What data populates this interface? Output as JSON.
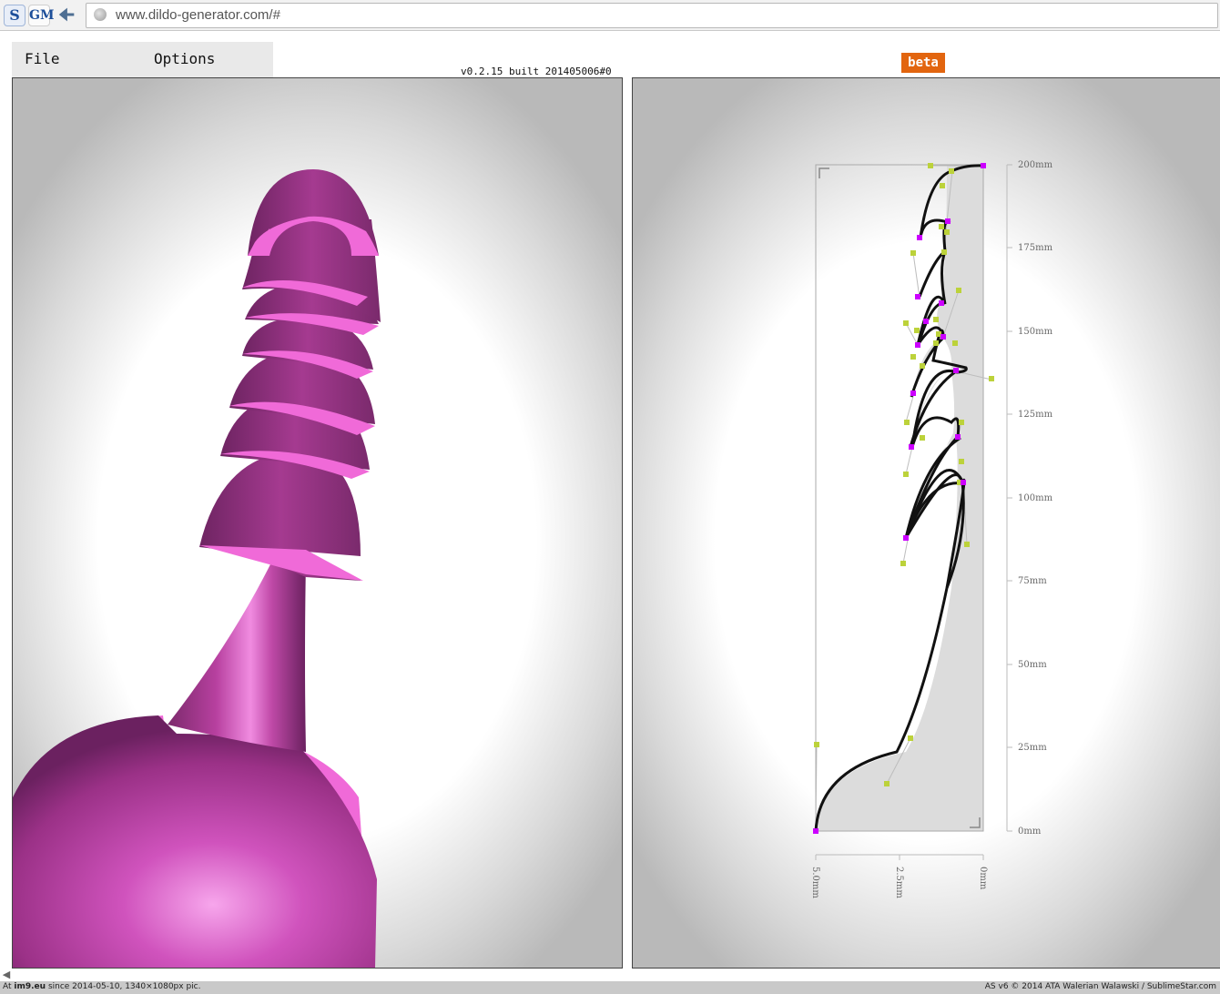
{
  "browser": {
    "ext_s_label": "S",
    "ext_gm_label": "GM",
    "back_icon": "arrow-left-icon",
    "url": "www.dildo-generator.com/#"
  },
  "menu": {
    "file_label": "File",
    "options_label": "Options"
  },
  "version": "v0.2.15 built 201405006#0",
  "beta_label": "beta",
  "editor": {
    "y_axis": {
      "labels": [
        "200mm",
        "175mm",
        "150mm",
        "125mm",
        "100mm",
        "75mm",
        "50mm",
        "25mm",
        "0mm"
      ]
    },
    "x_axis": {
      "labels": [
        "5.0mm",
        "2.5mm",
        "0mm"
      ]
    },
    "colors": {
      "profile_fill": "#dcdcdc",
      "curve": "#111111",
      "anchor_point": "#cc00ff",
      "handle_point": "#bcd23a"
    }
  },
  "model": {
    "color": "#e35fcf",
    "shade": "#8a2b78"
  },
  "footer": {
    "left_prefix": "At",
    "left_site": "im9.eu",
    "left_text": "since 2014-05-10, 1340×1080px pic.",
    "right_text": "AS v6 © 2014 ATA Walerian Walawski / SublimeStar.com"
  }
}
